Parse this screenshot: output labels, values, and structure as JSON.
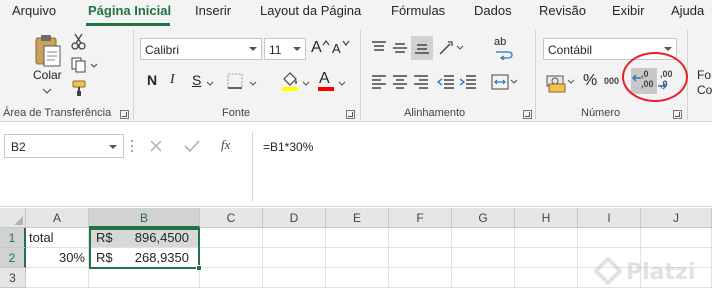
{
  "ribbon": {
    "tabs": [
      {
        "label": "Arquivo"
      },
      {
        "label": "Página Inicial",
        "active": true
      },
      {
        "label": "Inserir"
      },
      {
        "label": "Layout da Página"
      },
      {
        "label": "Fórmulas"
      },
      {
        "label": "Dados"
      },
      {
        "label": "Revisão"
      },
      {
        "label": "Exibir"
      },
      {
        "label": "Ajuda"
      }
    ],
    "groups": {
      "clipboard": {
        "label": "Área de Transferência",
        "paste_label": "Colar"
      },
      "font": {
        "label": "Fonte",
        "font_name": "Calibri",
        "font_size": "11",
        "grow_label": "A",
        "shrink_label": "A",
        "bold_label": "N",
        "italic_label": "I",
        "underline_label": "S",
        "font_color_label": "A",
        "fill_color": "#ffff00",
        "font_color": "#ff0000"
      },
      "alignment": {
        "label": "Alinhamento",
        "wrap_label": "ab"
      },
      "number": {
        "label": "Número",
        "format": "Contábil",
        "percent_label": "%",
        "thousands_label": "000",
        "increase_decimal_label": ",0\n,00",
        "decrease_decimal_label": ",00\n,0"
      },
      "styles": {
        "label_partial_1": "Fo",
        "label_partial_2": "Co"
      }
    }
  },
  "formula_bar": {
    "name_box": "B2",
    "fx_label": "fx",
    "formula": "=B1*30%"
  },
  "sheet": {
    "columns": [
      "A",
      "B",
      "C",
      "D",
      "E",
      "F",
      "G",
      "H",
      "I",
      "J"
    ],
    "rows": [
      "1",
      "2",
      "3"
    ],
    "selected_column": "B",
    "selected_rows": [
      "1",
      "2"
    ],
    "cells": {
      "A1": "total",
      "A2": "30%",
      "B1_currency": "R$",
      "B1_value": "896,4500",
      "B2_currency": "R$",
      "B2_value": "268,9350"
    }
  },
  "watermark": {
    "text": "Platzi"
  },
  "colors": {
    "accent": "#217346",
    "annotation": "#e8202a"
  }
}
